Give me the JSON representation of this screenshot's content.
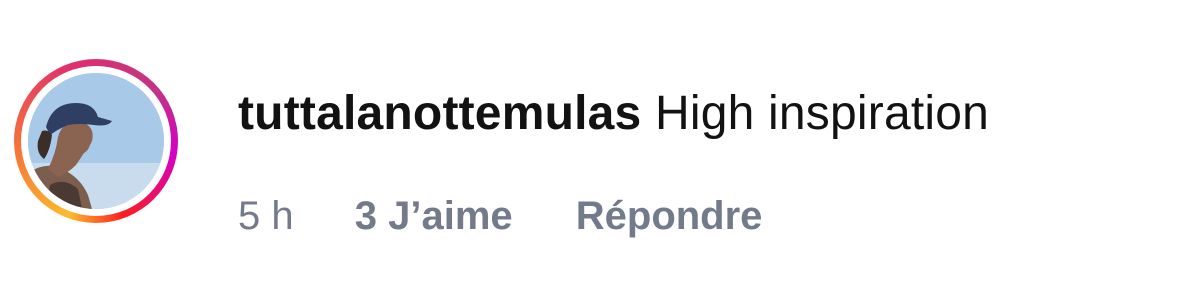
{
  "comment": {
    "username": "tuttalanottemulas",
    "text": "High inspiration",
    "timestamp": "5 h",
    "likes_label": "3 J’aime",
    "reply_label": "Répondre"
  },
  "colors": {
    "text_primary": "#121212",
    "text_secondary": "#737b8b",
    "story_ring_start": "#fdbb2d",
    "story_ring_end": "#d300c5"
  },
  "icons": {
    "avatar": "profile-photo-with-story-ring"
  }
}
